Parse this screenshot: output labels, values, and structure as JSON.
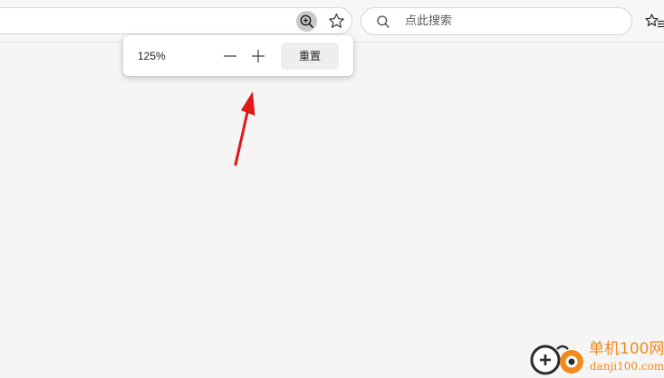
{
  "toolbar": {
    "zoom_icon": "zoom-in-magnifier-icon",
    "favorite_icon": "star-outline-icon",
    "favorites_list_icon": "star-with-lines-icon"
  },
  "search": {
    "placeholder": "点此搜索",
    "icon": "search-icon"
  },
  "zoom_popup": {
    "level": "125%",
    "decrease_icon": "minus-icon",
    "increase_icon": "plus-icon",
    "reset_label": "重置"
  },
  "annotation": {
    "arrow_color": "#e01818"
  },
  "watermark": {
    "brand": "单机100网",
    "url": "danji100.com",
    "color": "#f08a1c"
  }
}
